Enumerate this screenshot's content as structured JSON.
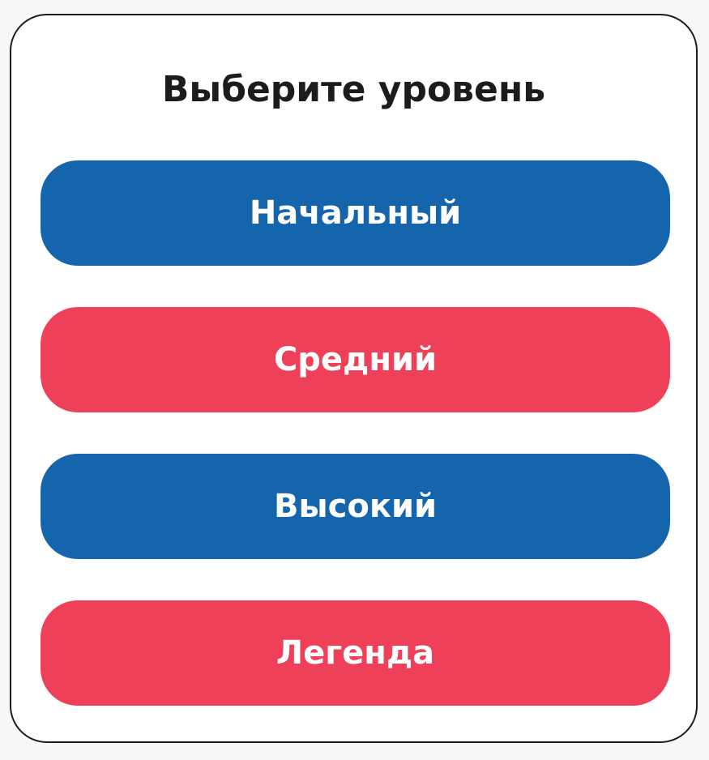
{
  "title": "Выберите уровень",
  "levels": [
    {
      "label": "Начальный",
      "color": "#1565ac"
    },
    {
      "label": "Средний",
      "color": "#ef405a"
    },
    {
      "label": "Высокий",
      "color": "#1565ac"
    },
    {
      "label": "Легенда",
      "color": "#ef405a"
    }
  ],
  "colors": {
    "background": "#ffffff",
    "border": "#1c1c1c",
    "title_text": "#1c1c1c",
    "button_text": "#ffffff"
  }
}
